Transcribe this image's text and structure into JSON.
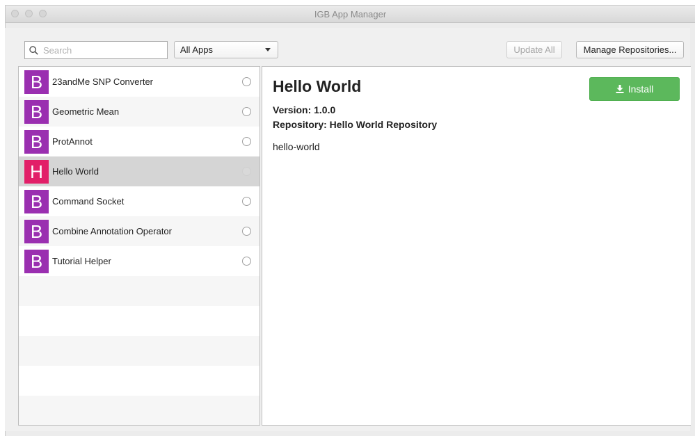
{
  "window": {
    "title": "IGB App Manager"
  },
  "toolbar": {
    "search_placeholder": "Search",
    "filter_selected": "All Apps",
    "update_all_label": "Update All",
    "manage_repositories_label": "Manage Repositories..."
  },
  "apps": [
    {
      "letter": "B",
      "name": "23andMe SNP Converter",
      "color": "#9a2fb0"
    },
    {
      "letter": "B",
      "name": "Geometric Mean",
      "color": "#9a2fb0"
    },
    {
      "letter": "B",
      "name": "ProtAnnot",
      "color": "#9a2fb0"
    },
    {
      "letter": "H",
      "name": "Hello World",
      "color": "#e21f68",
      "selected": true
    },
    {
      "letter": "B",
      "name": "Command Socket",
      "color": "#9a2fb0"
    },
    {
      "letter": "B",
      "name": "Combine Annotation Operator",
      "color": "#9a2fb0"
    },
    {
      "letter": "B",
      "name": "Tutorial Helper",
      "color": "#9a2fb0"
    }
  ],
  "detail": {
    "title": "Hello World",
    "version": "Version: 1.0.0",
    "repository": "Repository: Hello World Repository",
    "description": "hello-world",
    "install_label": "Install",
    "install_color": "#5cb85c"
  }
}
